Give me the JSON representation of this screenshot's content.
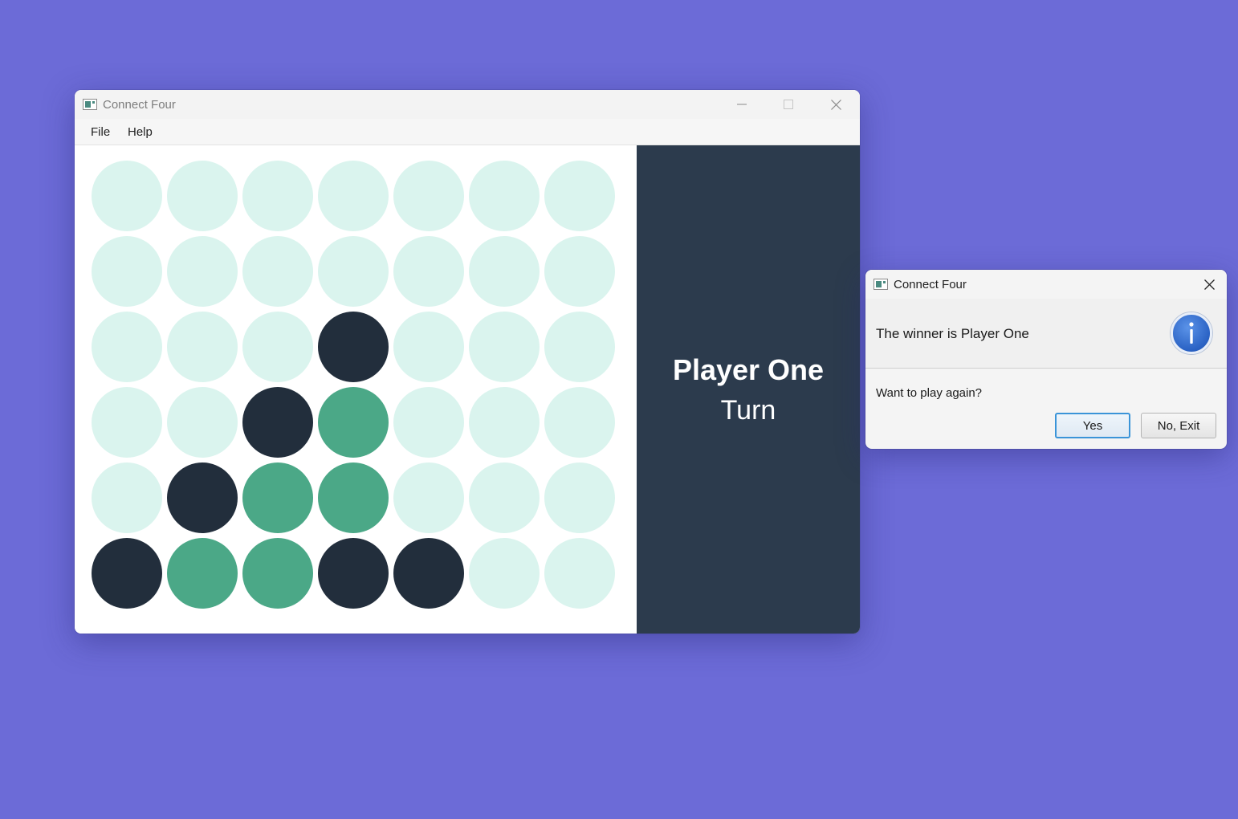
{
  "main_window": {
    "title": "Connect Four",
    "menu": [
      "File",
      "Help"
    ],
    "board": {
      "rows": 6,
      "columns": 7,
      "cells": [
        [
          "empty",
          "empty",
          "empty",
          "empty",
          "empty",
          "empty",
          "empty"
        ],
        [
          "empty",
          "empty",
          "empty",
          "empty",
          "empty",
          "empty",
          "empty"
        ],
        [
          "empty",
          "empty",
          "empty",
          "dark",
          "empty",
          "empty",
          "empty"
        ],
        [
          "empty",
          "empty",
          "dark",
          "green",
          "empty",
          "empty",
          "empty"
        ],
        [
          "empty",
          "dark",
          "green",
          "green",
          "empty",
          "empty",
          "empty"
        ],
        [
          "dark",
          "green",
          "green",
          "dark",
          "dark",
          "empty",
          "empty"
        ]
      ]
    },
    "status": {
      "player": "Player One",
      "turn_label": "Turn"
    }
  },
  "dialog": {
    "title": "Connect Four",
    "message": "The winner is Player One",
    "question": "Want to play again?",
    "yes_label": "Yes",
    "no_label": "No, Exit",
    "icon": "info-icon"
  },
  "colors": {
    "desktop": "#6c6bd7",
    "empty_cell": "#daf4ee",
    "dark_disc": "#222e3c",
    "green_disc": "#4ba887",
    "side_panel": "#2c3b4d",
    "info_icon": "#2a62c4"
  }
}
